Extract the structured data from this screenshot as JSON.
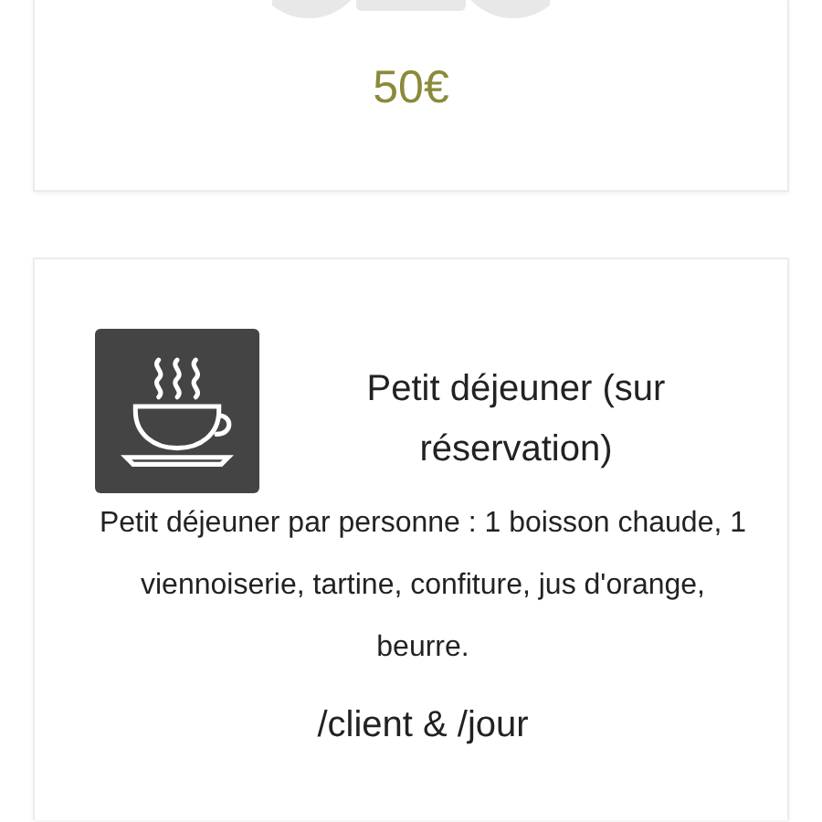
{
  "cards": [
    {
      "kind": "price",
      "price": "50€"
    },
    {
      "kind": "service",
      "title": "Petit déjeuner (sur réservation)",
      "description": "Petit déjeuner par personne : 1 boisson chaude, 1 viennoiserie, tartine, confiture, jus d'orange, beurre.",
      "unit": "/client & /jour"
    }
  ]
}
